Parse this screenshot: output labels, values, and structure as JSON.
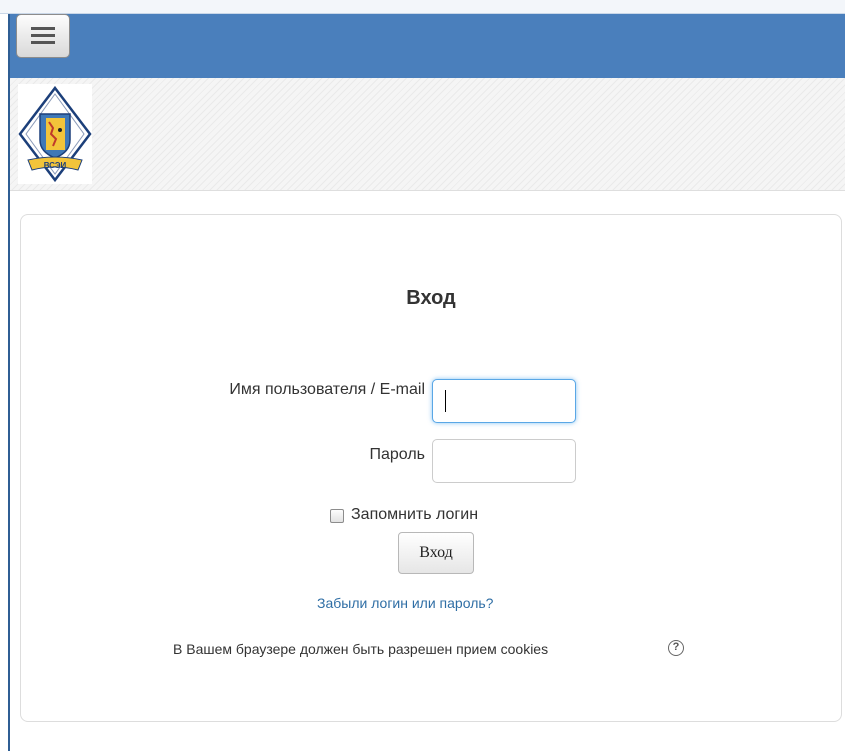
{
  "header": {
    "menu_icon": "hamburger-icon",
    "logo_text": "ВСЭИ",
    "colors": {
      "navbar": "#4a7fbc",
      "link": "#2f6ea5",
      "focus": "#5aa7e6"
    }
  },
  "login": {
    "title": "Вход",
    "username_label": "Имя пользователя / E-mail",
    "username_value": "",
    "password_label": "Пароль",
    "password_value": "",
    "remember_label": "Запомнить логин",
    "remember_checked": false,
    "submit_label": "Вход",
    "forgot_link": "Забыли логин или пароль?",
    "cookies_note": "В Вашем браузере должен быть разрешен прием cookies",
    "help_icon_glyph": "?"
  }
}
